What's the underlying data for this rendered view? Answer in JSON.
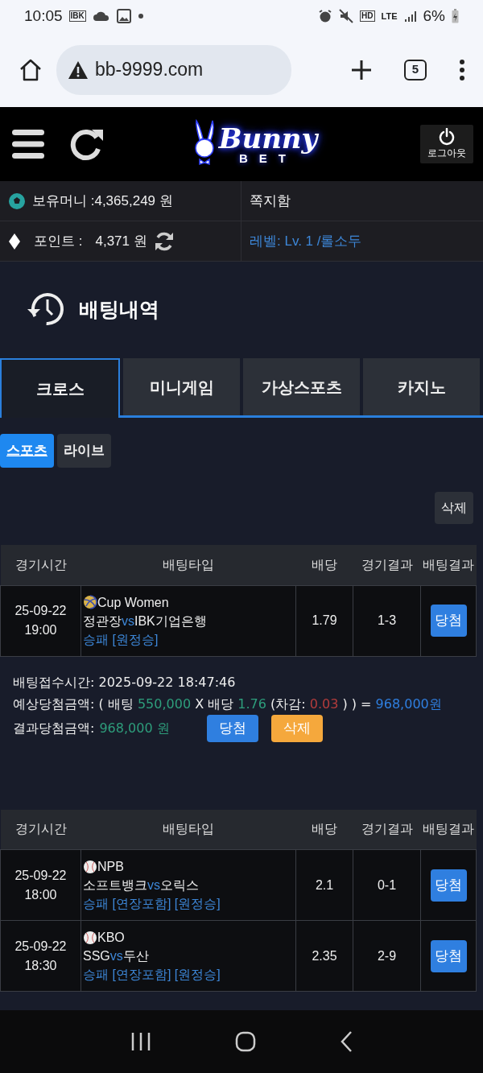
{
  "status_bar": {
    "time": "10:05",
    "notice_badge": "IBK",
    "hd_label": "HD",
    "network": "LTE",
    "battery": "6%"
  },
  "browser": {
    "url": "bb-9999.com",
    "tab_count": "5"
  },
  "header": {
    "logo_top": "Bunny",
    "logo_bottom": "BET",
    "logout": "로그아웃"
  },
  "account": {
    "money": "보유머니 :4,365,249 원",
    "messages": "쪽지함",
    "points_label": "포인트 :",
    "points_value": "4,371 원",
    "level": "레벨: Lv. 1 /롤소두"
  },
  "page_title": "배팅내역",
  "tabs": [
    {
      "label": "크로스",
      "selected": true
    },
    {
      "label": "미니게임",
      "selected": false
    },
    {
      "label": "가상스포츠",
      "selected": false
    },
    {
      "label": "카지노",
      "selected": false
    }
  ],
  "subtabs": [
    {
      "label": "스포츠",
      "selected": true
    },
    {
      "label": "라이브",
      "selected": false
    }
  ],
  "delete_all": "삭제",
  "slips": [
    {
      "columns": [
        "경기시간",
        "배팅타입",
        "배당",
        "경기결과",
        "배팅결과"
      ],
      "rows": [
        {
          "date": "25-09-22",
          "time": "19:00",
          "kind": "volleyball",
          "league": "Cup Women",
          "home": "정관장",
          "vs": "vs",
          "away": "IBK기업은행",
          "market": "승패 [원정승]",
          "odds": "1.79",
          "score": "1-3",
          "result": "당첨"
        }
      ],
      "summary": {
        "receipt": "배팅접수시간: 2025-09-22 18:47:46",
        "expected": [
          {
            "kind": "plain",
            "text": "예상당첨금액: ( 배팅 "
          },
          {
            "kind": "good",
            "text": "550,000"
          },
          {
            "kind": "plain",
            "text": " X 배당 "
          },
          {
            "kind": "good",
            "text": "1.76"
          },
          {
            "kind": "plain",
            "text": " (차감: "
          },
          {
            "kind": "bad",
            "text": "0.03"
          },
          {
            "kind": "plain",
            "text": " ) ) = "
          },
          {
            "kind": "total",
            "text": "968,000원"
          }
        ],
        "result_label": "결과당첨금액:",
        "result_value": "968,000 원",
        "win_button": "당첨",
        "delete_button": "삭제"
      }
    },
    {
      "columns": [
        "경기시간",
        "배팅타입",
        "배당",
        "경기결과",
        "배팅결과"
      ],
      "rows": [
        {
          "date": "25-09-22",
          "time": "18:00",
          "kind": "baseball",
          "league": "NPB",
          "home": "소프트뱅크",
          "vs": "vs",
          "away": "오릭스",
          "market": "승패 [연장포함] [원정승]",
          "odds": "2.1",
          "score": "0-1",
          "result": "당첨"
        },
        {
          "date": "25-09-22",
          "time": "18:30",
          "kind": "baseball",
          "league": "KBO",
          "home": "SSG",
          "vs": "vs",
          "away": "두산",
          "market": "승패 [연장포함] [원정승]",
          "odds": "2.35",
          "score": "2-9",
          "result": "당첨"
        }
      ]
    }
  ]
}
